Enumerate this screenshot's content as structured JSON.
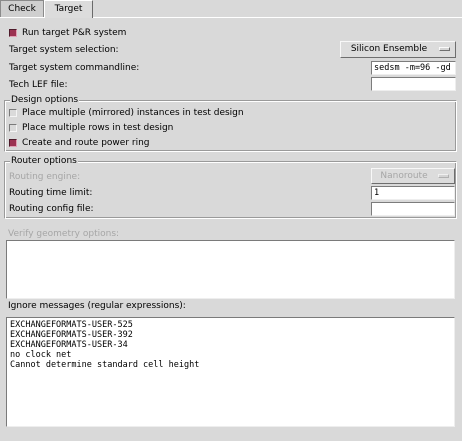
{
  "tabs": [
    {
      "label": "Check",
      "active": false
    },
    {
      "label": "Target",
      "active": true
    }
  ],
  "run_target": {
    "label": "Run target P&R system",
    "checked": true
  },
  "target_selection": {
    "label": "Target system selection:",
    "value": "Silicon Ensemble"
  },
  "target_commandline": {
    "label": "Target system commandline:",
    "value": "sedsm -m=96 -gd"
  },
  "tech_lef": {
    "label": "Tech LEF file:",
    "value": ""
  },
  "design_options": {
    "title": "Design options",
    "items": [
      {
        "label": "Place multiple (mirrored) instances in test design",
        "checked": false
      },
      {
        "label": "Place multiple rows in test design",
        "checked": false
      },
      {
        "label": "Create and route power ring",
        "checked": true
      }
    ]
  },
  "router_options": {
    "title": "Router options",
    "engine": {
      "label": "Routing engine:",
      "value": "Nanoroute",
      "disabled": true
    },
    "time_limit": {
      "label": "Routing time limit:",
      "value": "1"
    },
    "config_file": {
      "label": "Routing config file:",
      "value": ""
    }
  },
  "verify_geometry": {
    "label": "Verify geometry options:",
    "disabled": true,
    "lines": []
  },
  "ignore_messages": {
    "label": "Ignore messages (regular expressions):",
    "lines": [
      "EXCHANGEFORMATS-USER-525",
      "EXCHANGEFORMATS-USER-392",
      "EXCHANGEFORMATS-USER-34",
      "no clock net",
      "Cannot determine standard cell height"
    ]
  },
  "colors": {
    "checked": "#9c3251",
    "background": "#d9d9d9"
  }
}
